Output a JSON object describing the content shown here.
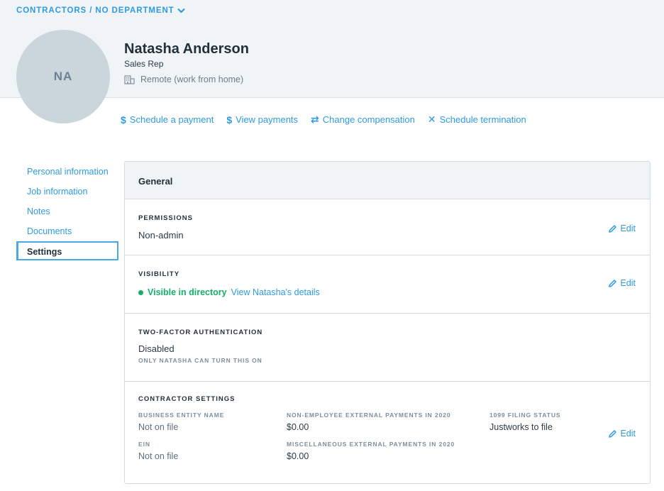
{
  "breadcrumb": {
    "label": "CONTRACTORS / NO DEPARTMENT"
  },
  "profile": {
    "initials": "NA",
    "name": "Natasha Anderson",
    "job_title": "Sales Rep",
    "location": "Remote (work from home)"
  },
  "actions": [
    {
      "icon": "dollar-icon",
      "glyph": "$",
      "label": "Schedule a payment"
    },
    {
      "icon": "dollar-icon",
      "glyph": "$",
      "label": "View payments"
    },
    {
      "icon": "swap-icon",
      "glyph": "⇄",
      "label": "Change compensation"
    },
    {
      "icon": "close-icon",
      "glyph": "✕",
      "label": "Schedule termination"
    }
  ],
  "sidebar": {
    "items": [
      {
        "label": "Personal information"
      },
      {
        "label": "Job information"
      },
      {
        "label": "Notes"
      },
      {
        "label": "Documents"
      },
      {
        "label": "Settings",
        "active": true
      }
    ]
  },
  "panel": {
    "title": "General",
    "edit_label": "Edit",
    "permissions": {
      "label": "PERMISSIONS",
      "value": "Non-admin"
    },
    "visibility": {
      "label": "VISIBILITY",
      "status": "Visible in directory",
      "link": "View Natasha's details",
      "status_color": "#15b06a"
    },
    "two_factor": {
      "label": "TWO-FACTOR AUTHENTICATION",
      "value": "Disabled",
      "note": "ONLY NATASHA CAN TURN THIS ON"
    },
    "contractor": {
      "label": "CONTRACTOR SETTINGS",
      "business_entity": {
        "label": "BUSINESS ENTITY NAME",
        "value": "Not on file"
      },
      "ein": {
        "label": "EIN",
        "value": "Not on file"
      },
      "non_employee_payments": {
        "label": "NON-EMPLOYEE EXTERNAL PAYMENTS IN 2020",
        "value": "$0.00"
      },
      "misc_payments": {
        "label": "MISCELLANEOUS EXTERNAL PAYMENTS IN 2020",
        "value": "$0.00"
      },
      "filing_status": {
        "label": "1099 FILING STATUS",
        "value": "Justworks to file"
      }
    }
  },
  "colors": {
    "accent": "#2d9be2",
    "header_bg": "#f1f4f7",
    "avatar_bg": "#cbd5dc"
  }
}
